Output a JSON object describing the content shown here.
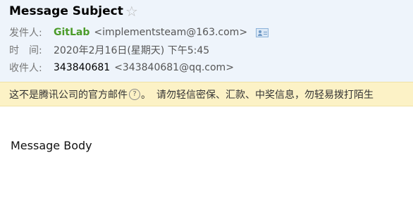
{
  "email": {
    "subject": "Message Subject",
    "star_glyph": "☆",
    "from_label": "发件人:",
    "from_name": "GitLab",
    "from_address": "<implementsteam@163.com>",
    "time_label": "时　间:",
    "time_value": "2020年2月16日(星期天) 下午5:45",
    "to_label": "收件人:",
    "to_name": "343840681",
    "to_address": "<343840681@qq.com>",
    "body": "Message Body"
  },
  "warning": {
    "text": "这不是腾讯公司的官方邮件",
    "help_glyph": "?",
    "punct": "。",
    "advice": "请勿轻信密保、汇款、中奖信息，勿轻易拨打陌生"
  },
  "colors": {
    "header_bg": "#eef4fb",
    "warning_bg": "#fcf2c6",
    "sender_green": "#4c9c2a"
  },
  "icons": [
    "star-icon",
    "contact-card-icon",
    "help-icon"
  ]
}
